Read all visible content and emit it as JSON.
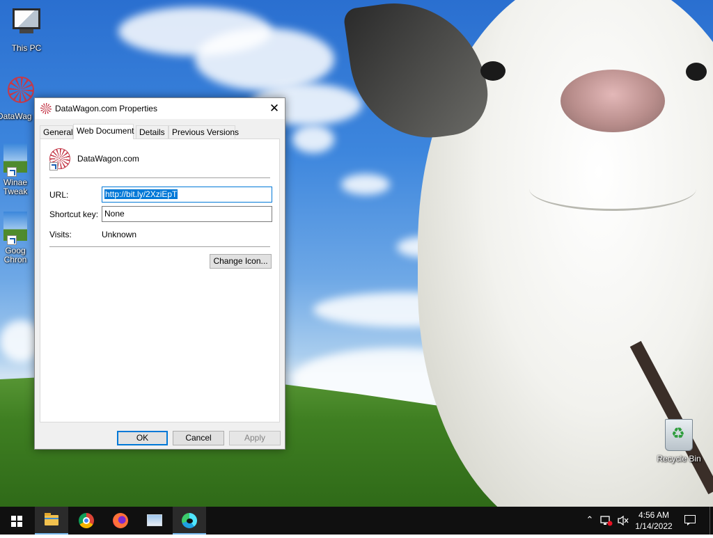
{
  "desktop": {
    "icons": [
      {
        "label": "This PC"
      },
      {
        "label": "DataWag"
      },
      {
        "label": "Winae Tweak"
      },
      {
        "label": "Goog Chron"
      },
      {
        "label": "Recycle Bin"
      }
    ]
  },
  "dialog": {
    "title": "DataWagon.com Properties",
    "close_glyph": "✕",
    "tabs": [
      {
        "label": "General"
      },
      {
        "label": "Web Document",
        "active": true
      },
      {
        "label": "Details"
      },
      {
        "label": "Previous Versions"
      }
    ],
    "site_name": "DataWagon.com",
    "url": {
      "label": "URL:",
      "value": "http://bit.ly/2XziEpT"
    },
    "shortcut": {
      "label": "Shortcut key:",
      "value": "None"
    },
    "visits": {
      "label": "Visits:",
      "value": "Unknown"
    },
    "change_icon_label": "Change Icon...",
    "ok_label": "OK",
    "cancel_label": "Cancel",
    "apply_label": "Apply"
  },
  "taskbar": {
    "tray_chevron": "⌃",
    "clock": {
      "time": "4:56 AM",
      "date": "1/14/2022"
    }
  },
  "colors": {
    "accent": "#0078d7",
    "taskbar": "#101010"
  }
}
